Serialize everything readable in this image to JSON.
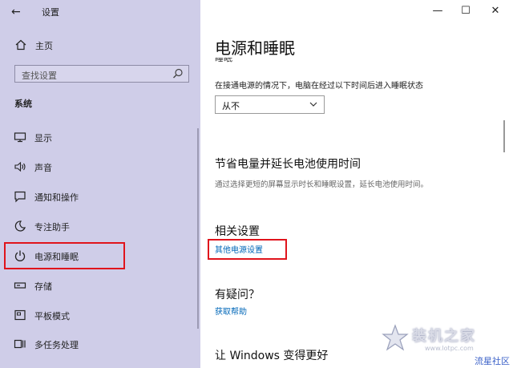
{
  "window": {
    "title": "设置",
    "controls": {
      "minimize": "—",
      "maximize": "☐",
      "close": "✕"
    }
  },
  "sidebar": {
    "home_label": "主页",
    "search_placeholder": "查找设置",
    "section_title": "系统",
    "items": [
      {
        "label": "显示",
        "icon": "monitor-icon"
      },
      {
        "label": "声音",
        "icon": "speaker-icon"
      },
      {
        "label": "通知和操作",
        "icon": "notification-icon"
      },
      {
        "label": "专注助手",
        "icon": "moon-icon"
      },
      {
        "label": "电源和睡眠",
        "icon": "power-icon",
        "selected": true
      },
      {
        "label": "存储",
        "icon": "storage-icon"
      },
      {
        "label": "平板模式",
        "icon": "tablet-icon"
      },
      {
        "label": "多任务处理",
        "icon": "multitask-icon"
      }
    ]
  },
  "main": {
    "page_title": "电源和睡眠",
    "subheading_clipped": "睡眠",
    "sleep_description": "在接通电源的情况下，电脑在经过以下时间后进入睡眠状态",
    "sleep_value": "从不",
    "battery_heading": "节省电量并延长电池使用时间",
    "battery_text": "通过选择更短的屏幕显示时长和睡眠设置，延长电池使用时间。",
    "related_heading": "相关设置",
    "related_link": "其他电源设置",
    "questions_heading": "有疑问？",
    "help_link": "获取帮助",
    "improve_heading": "让 Windows 变得更好"
  },
  "watermark": {
    "brand": "装机之家",
    "url": "www.lotpc.com",
    "corner_text": "流星社区"
  },
  "colors": {
    "sidebar_bg": "#cfcde8",
    "highlight_border": "#e0141c",
    "link": "#0067b8"
  }
}
